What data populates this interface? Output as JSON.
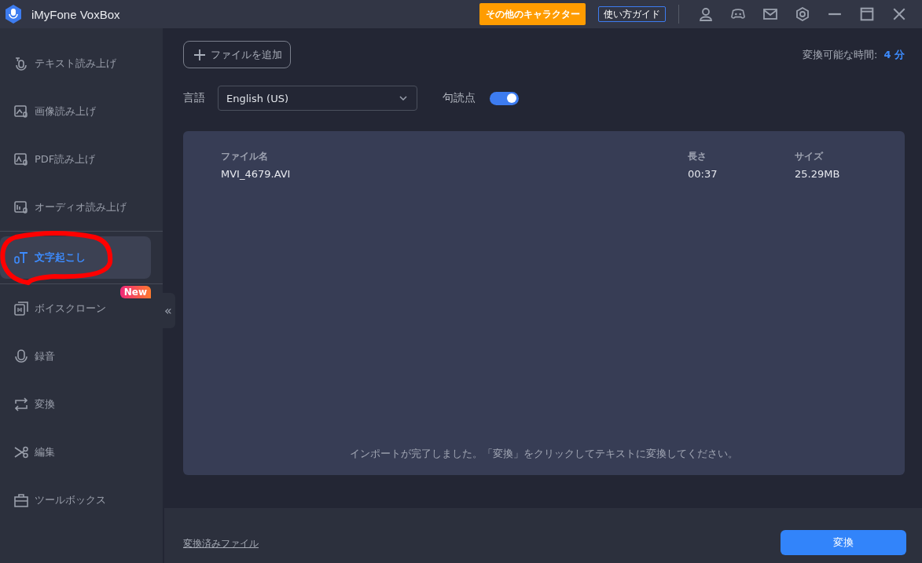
{
  "window": {
    "title": "iMyFone VoxBox"
  },
  "titlebar": {
    "characters_button": "その他のキャラクター",
    "guide_button": "使い方ガイド"
  },
  "sidebar": {
    "items": [
      {
        "label": "テキスト読み上げ",
        "selected": false
      },
      {
        "label": "画像読み上げ",
        "selected": false
      },
      {
        "label": "PDF読み上げ",
        "selected": false
      },
      {
        "label": "オーディオ読み上げ",
        "selected": false
      },
      {
        "label": "文字起こし",
        "selected": true
      },
      {
        "label": "ボイスクローン",
        "selected": false,
        "badge": "New"
      },
      {
        "label": "録音",
        "selected": false
      },
      {
        "label": "変換",
        "selected": false
      },
      {
        "label": "編集",
        "selected": false
      },
      {
        "label": "ツールボックス",
        "selected": false
      }
    ],
    "collapse": "«"
  },
  "toolbar": {
    "add_file": "ファイルを追加",
    "time_label": "変換可能な時間:",
    "time_value": "4 分"
  },
  "options": {
    "language_label": "言語",
    "language": "English (US)",
    "punctuation_label": "句読点",
    "punctuation_on": true
  },
  "file_table": {
    "columns": [
      "ファイル名",
      "長さ",
      "サイズ"
    ],
    "rows": [
      [
        "MVI_4679.AVI",
        "00:37",
        "25.29MB"
      ]
    ],
    "message": "インポートが完了しました。「変換」をクリックしてテキストに変換してください。"
  },
  "footer": {
    "converted_link": "変換済みファイル",
    "convert_button": "変換"
  }
}
